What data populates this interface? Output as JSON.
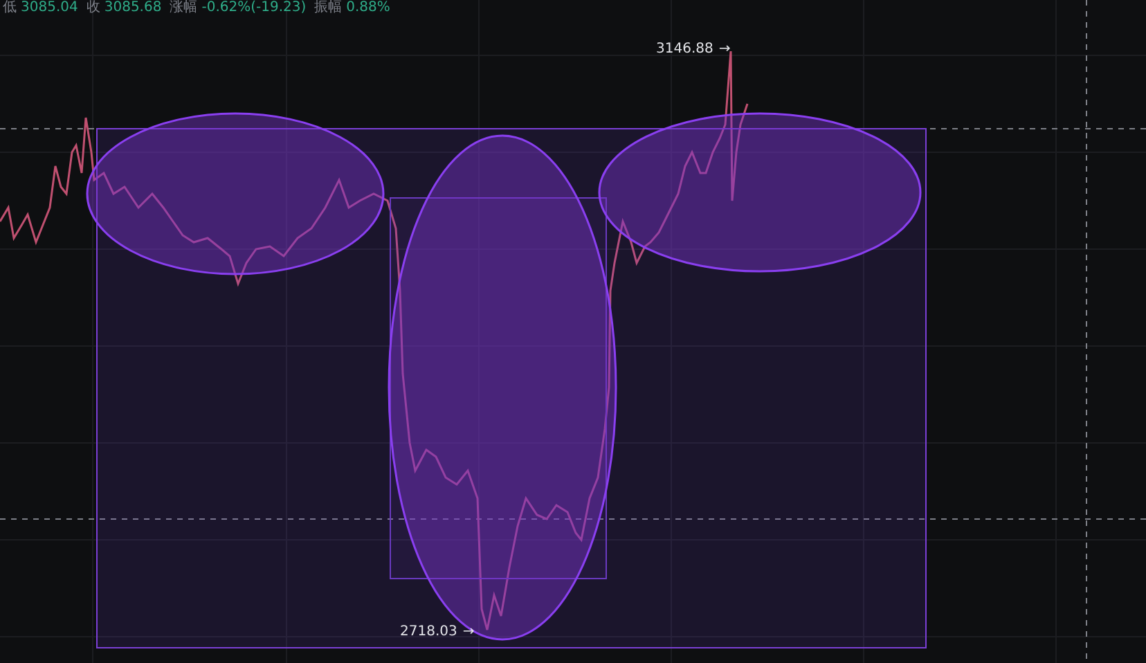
{
  "stats": [
    {
      "label": "低",
      "value": "3085.04"
    },
    {
      "label": "收",
      "value": "3085.68"
    },
    {
      "label": "涨幅",
      "value": "-0.62%(-19.23)"
    },
    {
      "label": "振幅",
      "value": "0.88%"
    }
  ],
  "high_label": {
    "value": "3146.88",
    "arrow": "→"
  },
  "low_label": {
    "value": "2718.03",
    "arrow": "→"
  }
}
